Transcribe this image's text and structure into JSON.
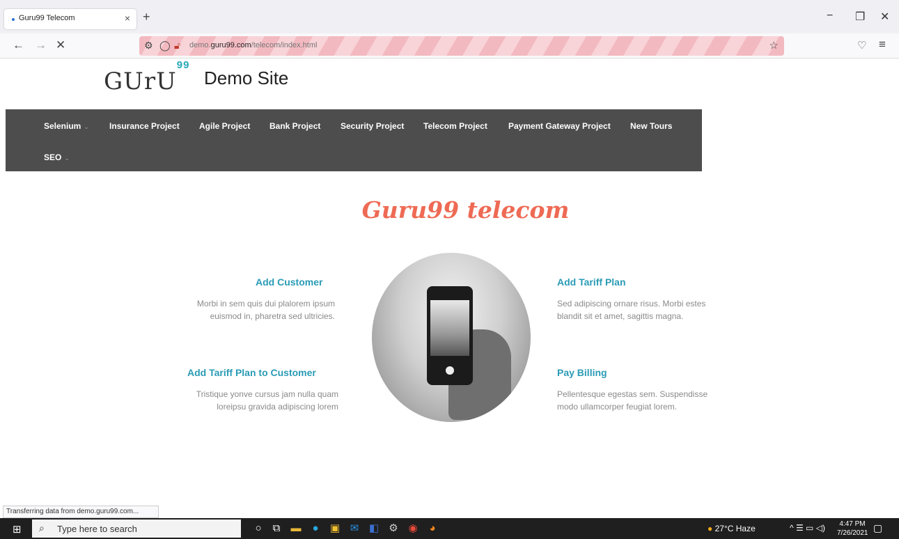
{
  "browser": {
    "tab_title": "Guru99 Telecom",
    "tab_close": "×",
    "new_tab": "+",
    "url_host_prefix": "demo.",
    "url_host": "guru99.com",
    "url_path": "/telecom/index.html"
  },
  "header": {
    "logo_text": "GUrU",
    "logo_sup": "99",
    "site_name": "Demo Site"
  },
  "nav": {
    "items": [
      {
        "label": "Selenium",
        "dropdown": true
      },
      {
        "label": "Insurance Project"
      },
      {
        "label": "Agile Project"
      },
      {
        "label": "Bank Project"
      },
      {
        "label": "Security Project"
      },
      {
        "label": "Telecom Project"
      },
      {
        "label": "Payment Gateway Project"
      },
      {
        "label": "New Tours"
      },
      {
        "label": "SEO",
        "dropdown": true
      }
    ],
    "caret": "⌄"
  },
  "main": {
    "heading": "Guru99 telecom",
    "features": [
      {
        "title": "Add Customer",
        "desc": "Morbi in sem quis dui plalorem ipsum euismod in, pharetra sed ultricies."
      },
      {
        "title": "Add Tariff Plan",
        "desc": "Sed adipiscing ornare risus. Morbi estes blandit sit et amet, sagittis magna."
      },
      {
        "title": "Add Tariff Plan to Customer",
        "desc": "Tristique yonve cursus jam nulla quam loreipsu gravida adipiscing lorem"
      },
      {
        "title": "Pay Billing",
        "desc": "Pellentesque egestas sem. Suspendisse modo ullamcorper feugiat lorem."
      }
    ]
  },
  "status_bar": "Transferring data from demo.guru99.com...",
  "taskbar": {
    "search_placeholder": "Type here to search",
    "weather": "27°C Haze",
    "time": "4:47 PM",
    "date": "7/26/2021"
  },
  "colors": {
    "nav_bg": "#4d4d4d",
    "heading": "#ee6a54",
    "feature_title": "#2a9bb5"
  }
}
